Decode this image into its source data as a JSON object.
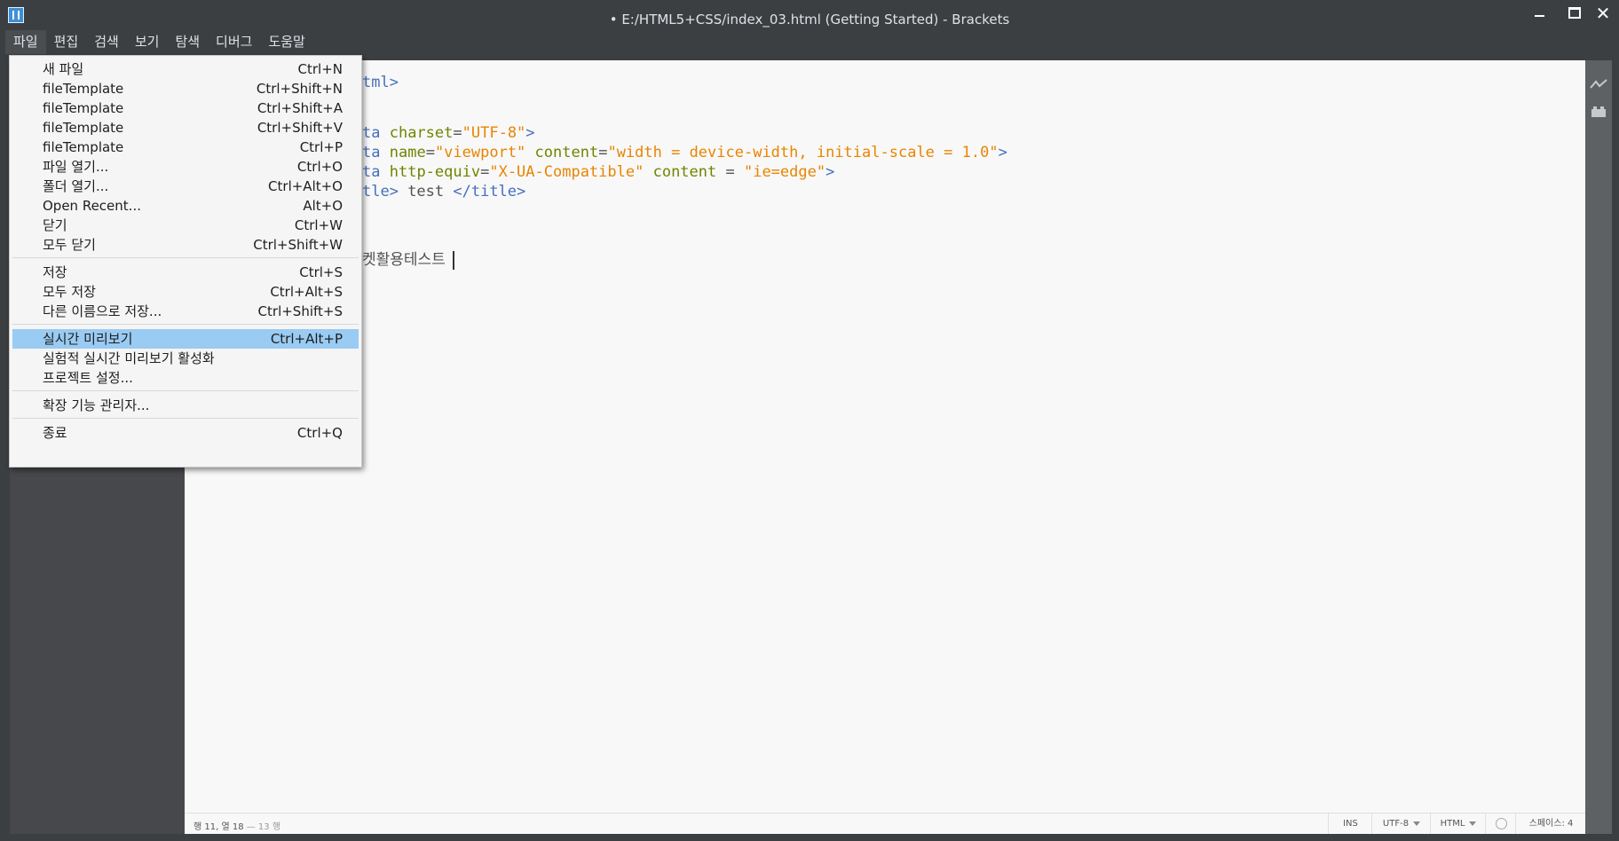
{
  "window": {
    "title": "• E:/HTML5+CSS/index_03.html (Getting Started) - Brackets",
    "close_glyph": "✕"
  },
  "menubar": {
    "items": [
      {
        "label": "파일"
      },
      {
        "label": "편집"
      },
      {
        "label": "검색"
      },
      {
        "label": "보기"
      },
      {
        "label": "탐색"
      },
      {
        "label": "디버그"
      },
      {
        "label": "도움말"
      }
    ]
  },
  "file_menu": {
    "items": [
      {
        "label": "새 파일",
        "shortcut": "Ctrl+N"
      },
      {
        "label": "fileTemplate",
        "shortcut": "Ctrl+Shift+N"
      },
      {
        "label": "fileTemplate",
        "shortcut": "Ctrl+Shift+A"
      },
      {
        "label": "fileTemplate",
        "shortcut": "Ctrl+Shift+V"
      },
      {
        "label": "fileTemplate",
        "shortcut": "Ctrl+P"
      },
      {
        "label": "파일 열기...",
        "shortcut": "Ctrl+O"
      },
      {
        "label": "폴더 열기...",
        "shortcut": "Ctrl+Alt+O"
      },
      {
        "label": "Open Recent...",
        "shortcut": "Alt+O"
      },
      {
        "label": "닫기",
        "shortcut": "Ctrl+W"
      },
      {
        "label": "모두 닫기",
        "shortcut": "Ctrl+Shift+W"
      },
      {
        "label": "저장",
        "shortcut": "Ctrl+S"
      },
      {
        "label": "모두 저장",
        "shortcut": "Ctrl+Alt+S"
      },
      {
        "label": "다른 이름으로 저장...",
        "shortcut": "Ctrl+Shift+S"
      },
      {
        "label": "실시간 미리보기",
        "shortcut": "Ctrl+Alt+P",
        "highlighted": true
      },
      {
        "label": "실험적 실시간 미리보기 활성화",
        "shortcut": ""
      },
      {
        "label": "프로젝트 설정...",
        "shortcut": ""
      },
      {
        "label": "확장 기능 관리자...",
        "shortcut": ""
      },
      {
        "label": "종료",
        "shortcut": "Ctrl+Q"
      }
    ]
  },
  "code": {
    "line1": {
      "tag_tail": "tml>"
    },
    "line2": {
      "tag": "ta",
      "attr": "charset",
      "eq": "=",
      "val": "\"UTF-8\"",
      "close": ">"
    },
    "line3": {
      "tag": "ta",
      "attr1": "name",
      "eq": "=",
      "val1": "\"viewport\"",
      "attr2": "content",
      "val2": "\"width = device-width, initial-scale = 1.0\"",
      "close": ">"
    },
    "line4": {
      "tag": "ta",
      "attr1": "http-equiv",
      "eq": "=",
      "val1": "\"X-UA-Compatible\"",
      "attr2": "content",
      "eq2": " = ",
      "val2": "\"ie=edge\"",
      "close": ">"
    },
    "line5": {
      "tag_open": "tle>",
      "text": " test ",
      "tag_close": "</title>"
    },
    "line6": {
      "text": "켓활용테스트"
    }
  },
  "statusbar": {
    "cursor_main": "행 11, 열 18",
    "cursor_muted": " — 13 행",
    "ins": "INS",
    "encoding": "UTF-8",
    "language": "HTML",
    "indent": "스페이스: 4"
  },
  "icons": {
    "app": "brackets-logo-icon",
    "live_preview": "live-preview-icon",
    "extensions": "extension-manager-icon"
  },
  "colors": {
    "chrome": "#3c3f41",
    "sidebar": "#47484b",
    "editor_bg": "#f8f8f8",
    "menu_highlight": "#99cbf3",
    "tag": "#446fbd",
    "attr": "#6d8600",
    "string": "#e88501"
  }
}
